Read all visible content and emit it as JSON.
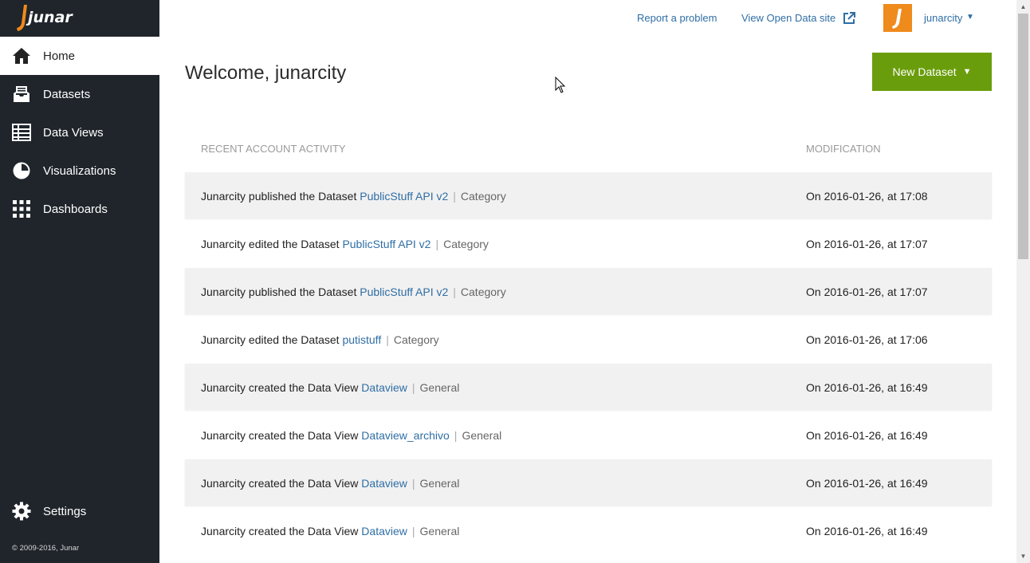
{
  "brand": {
    "logo_text": "junar"
  },
  "sidebar": {
    "items": [
      {
        "label": "Home",
        "icon": "home-icon"
      },
      {
        "label": "Datasets",
        "icon": "inbox-icon"
      },
      {
        "label": "Data Views",
        "icon": "table-icon"
      },
      {
        "label": "Visualizations",
        "icon": "pie-chart-icon"
      },
      {
        "label": "Dashboards",
        "icon": "grid-icon"
      }
    ],
    "settings_label": "Settings",
    "copyright": "© 2009-2016, Junar"
  },
  "topbar": {
    "report_label": "Report a problem",
    "view_site_label": "View Open Data site",
    "username": "junarcity"
  },
  "main": {
    "welcome": "Welcome, junarcity",
    "new_dataset_label": "New Dataset",
    "columns": {
      "activity": "RECENT ACCOUNT ACTIVITY",
      "modification": "MODIFICATION"
    },
    "rows": [
      {
        "text": "Junarcity published the Dataset",
        "link": "PublicStuff API v2",
        "category": "Category",
        "mod": "On 2016-01-26, at 17:08"
      },
      {
        "text": "Junarcity edited the Dataset",
        "link": "PublicStuff API v2",
        "category": "Category",
        "mod": "On 2016-01-26, at 17:07"
      },
      {
        "text": "Junarcity published the Dataset",
        "link": "PublicStuff API v2",
        "category": "Category",
        "mod": "On 2016-01-26, at 17:07"
      },
      {
        "text": "Junarcity edited the Dataset",
        "link": "putistuff",
        "category": "Category",
        "mod": "On 2016-01-26, at 17:06"
      },
      {
        "text": "Junarcity created the Data View",
        "link": "Dataview",
        "category": "General",
        "mod": "On 2016-01-26, at 16:49"
      },
      {
        "text": "Junarcity created the Data View",
        "link": "Dataview_archivo",
        "category": "General",
        "mod": "On 2016-01-26, at 16:49"
      },
      {
        "text": "Junarcity created the Data View",
        "link": "Dataview",
        "category": "General",
        "mod": "On 2016-01-26, at 16:49"
      },
      {
        "text": "Junarcity created the Data View",
        "link": "Dataview",
        "category": "General",
        "mod": "On 2016-01-26, at 16:49"
      }
    ]
  },
  "colors": {
    "sidebar_bg": "#1f252b",
    "accent_green": "#6a9d0c",
    "link_blue": "#2f6ea5",
    "avatar_orange": "#ef8a1c"
  }
}
